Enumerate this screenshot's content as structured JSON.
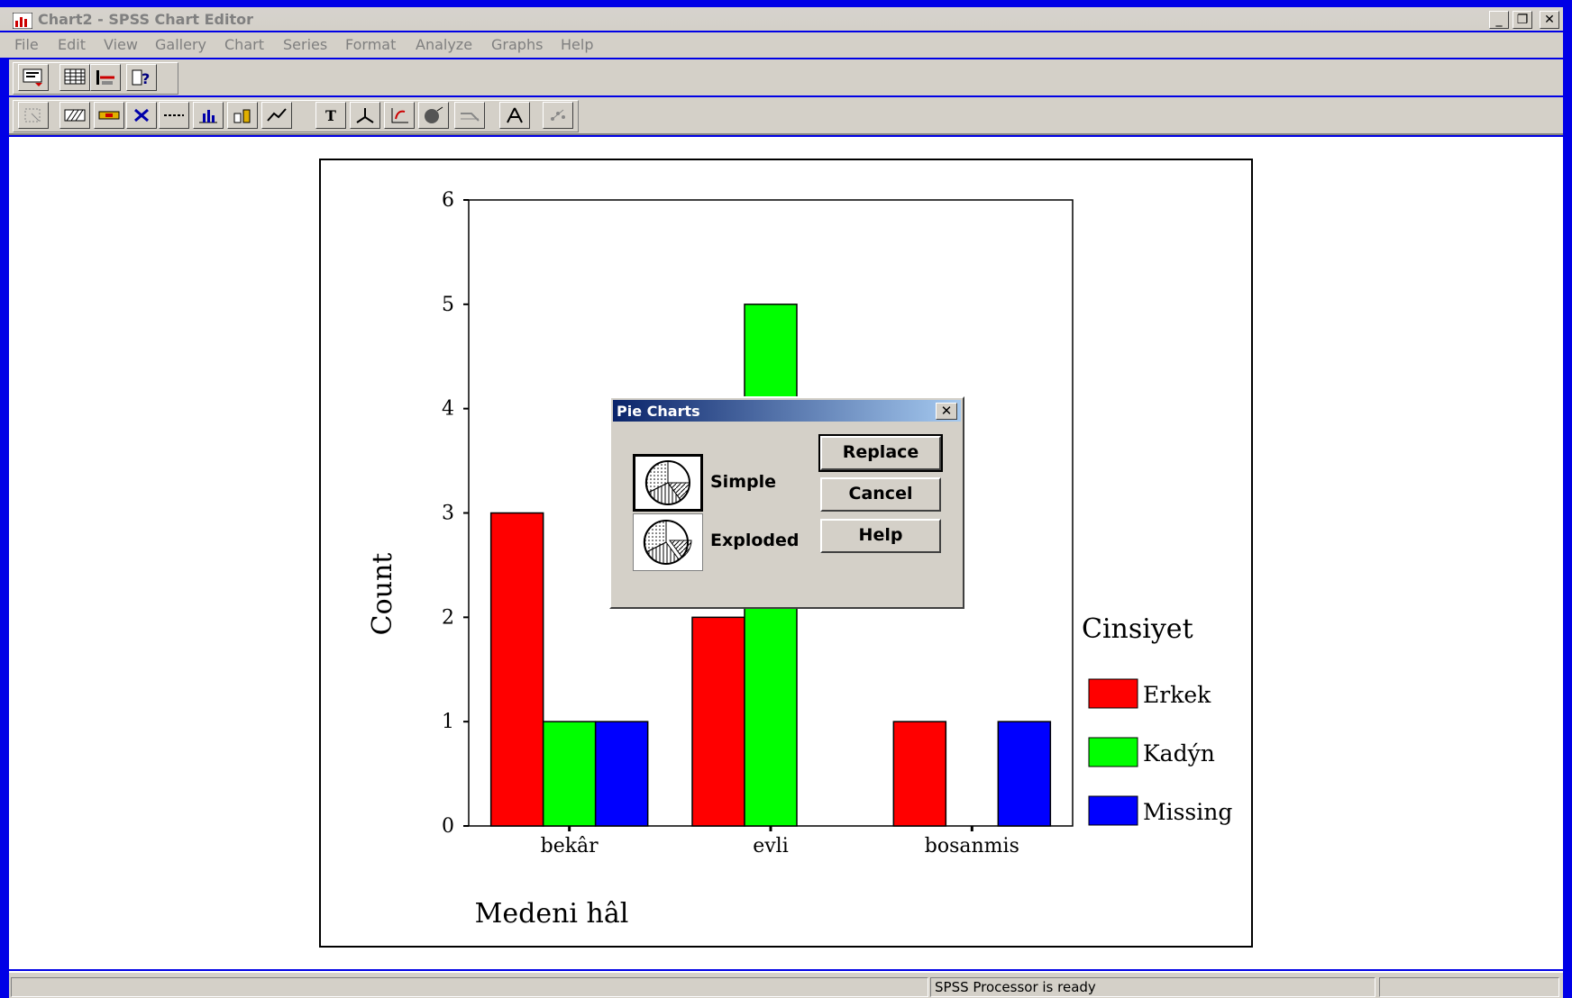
{
  "window": {
    "title": "Chart2 - SPSS Chart Editor"
  },
  "menu": [
    "File",
    "Edit",
    "View",
    "Gallery",
    "Chart",
    "Series",
    "Format",
    "Analyze",
    "Graphs",
    "Help"
  ],
  "status": {
    "text": "SPSS Processor  is ready"
  },
  "dialog": {
    "title": "Pie Charts",
    "options": [
      {
        "label": "Simple",
        "selected": true
      },
      {
        "label": "Exploded",
        "selected": false
      }
    ],
    "buttons": {
      "replace": "Replace",
      "cancel": "Cancel",
      "help": "Help"
    }
  },
  "chart_data": {
    "type": "bar",
    "categories": [
      "bekâr",
      "evli",
      "bosanmis"
    ],
    "series": [
      {
        "name": "Erkek",
        "color": "#ff0000",
        "values": [
          3,
          2,
          1
        ]
      },
      {
        "name": "Kadýn",
        "color": "#00ff00",
        "values": [
          1,
          5,
          0
        ]
      },
      {
        "name": "Missing",
        "color": "#0000ff",
        "values": [
          1,
          0,
          1
        ]
      }
    ],
    "xlabel": "Medeni hâl",
    "ylabel": "Count",
    "legend_title": "Cinsiyet",
    "legend_position": "right",
    "ylim": [
      0,
      6
    ],
    "yticks": [
      0,
      1,
      2,
      3,
      4,
      5,
      6
    ],
    "grid": false
  }
}
